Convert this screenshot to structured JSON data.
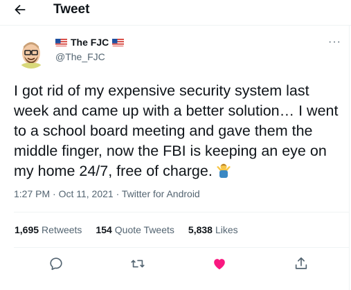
{
  "header": {
    "back_icon": "arrow-left-icon",
    "title": "Tweet"
  },
  "author": {
    "name": "The FJC",
    "handle": "@The_FJC",
    "flags": "flag-us-icon"
  },
  "tweet": {
    "text": "I got rid of my expensive security system last week and came up with a better solution… I went to a school board meeting and gave them the middle finger, now the FBI is keeping an eye on my home 24/7, free of charge.",
    "emoji": "man-shrugging-emoji"
  },
  "meta": {
    "timestamp": "1:27 PM · Oct 11, 2021 · Twitter for Android"
  },
  "stats": {
    "retweets_count": "1,695",
    "retweets_label": "Retweets",
    "quotes_count": "154",
    "quotes_label": "Quote Tweets",
    "likes_count": "5,838",
    "likes_label": "Likes"
  },
  "actions": [
    "reply-icon",
    "retweet-icon",
    "like-icon",
    "share-icon"
  ],
  "colors": {
    "like": "#f91880",
    "secondary_text": "#536471",
    "icon": "#536471"
  }
}
